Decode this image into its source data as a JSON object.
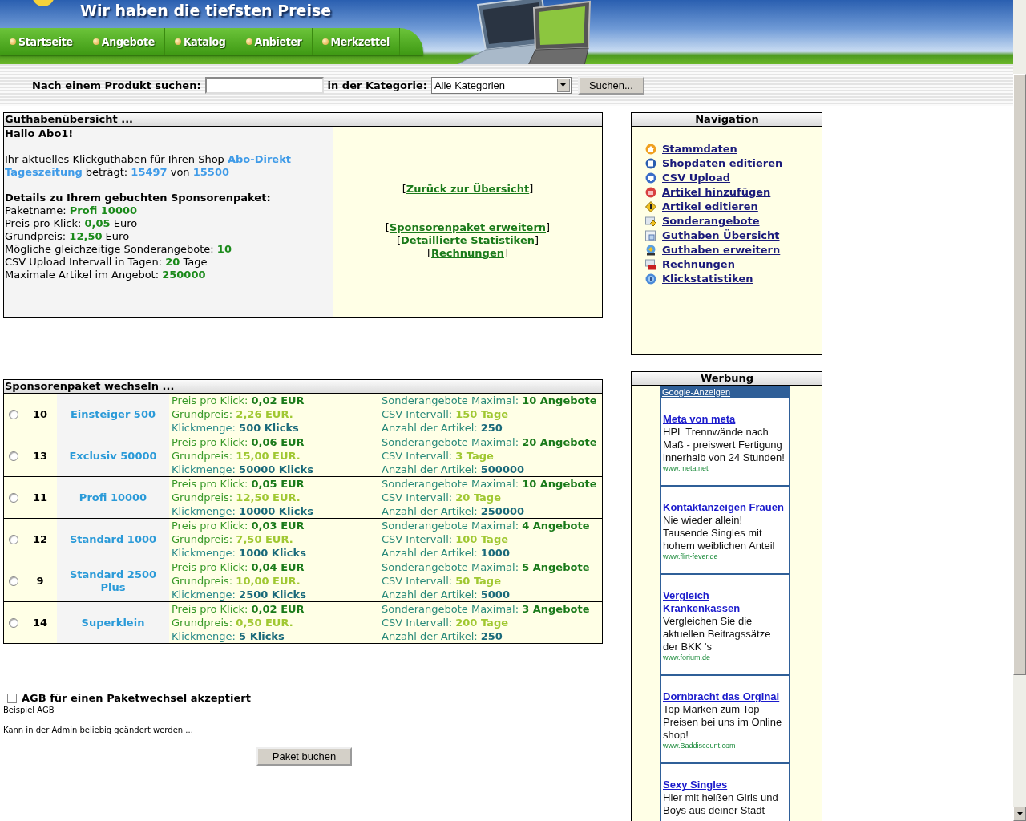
{
  "header": {
    "slogan": "Wir haben die tiefsten Preise",
    "tabs": [
      {
        "label": "Startseite"
      },
      {
        "label": "Angebote"
      },
      {
        "label": "Katalog"
      },
      {
        "label": "Anbieter"
      },
      {
        "label": "Merkzettel"
      }
    ]
  },
  "search": {
    "label": "Nach einem Produkt suchen:",
    "category_label": "in der Kategorie:",
    "category": "Alle Kategorien",
    "button": "Suchen..."
  },
  "balance": {
    "title": "Guthabenübersicht ...",
    "paragraphs": [
      [
        {
          "text": "Hallo Abo1!",
          "kind": "bold"
        }
      ],
      [
        {
          "text": "Ihr aktuelles Klickguthaben für Ihren Shop ",
          "kind": "plain"
        },
        {
          "text": "Abo-Direkt Tageszeitung",
          "kind": "blue"
        },
        {
          "text": " beträgt: ",
          "kind": "plain"
        },
        {
          "text": "15497",
          "kind": "blue"
        },
        {
          "text": " von ",
          "kind": "plain"
        },
        {
          "text": "15500",
          "kind": "blue"
        }
      ],
      [
        {
          "text": "Details zu Ihrem gebuchten Sponsorenpaket:",
          "kind": "bold"
        }
      ],
      [
        {
          "text": "Paketname: ",
          "kind": "plain"
        },
        {
          "text": "Profi 10000",
          "kind": "green"
        }
      ],
      [
        {
          "text": "Preis pro Klick: ",
          "kind": "plain"
        },
        {
          "text": "0,05",
          "kind": "green"
        },
        {
          "text": " Euro",
          "kind": "plain"
        }
      ],
      [
        {
          "text": "Grundpreis: ",
          "kind": "plain"
        },
        {
          "text": "12,50",
          "kind": "green"
        },
        {
          "text": " Euro",
          "kind": "plain"
        }
      ],
      [
        {
          "text": "Mögliche gleichzeitige Sonderangebote: ",
          "kind": "plain"
        },
        {
          "text": "10",
          "kind": "green"
        }
      ],
      [
        {
          "text": "CSV Upload Intervall in Tagen: ",
          "kind": "plain"
        },
        {
          "text": "20",
          "kind": "green"
        },
        {
          "text": " Tage",
          "kind": "plain"
        }
      ],
      [
        {
          "text": "Maximale Artikel im Angebot: ",
          "kind": "plain"
        },
        {
          "text": "250000",
          "kind": "green"
        }
      ]
    ],
    "link_groups": [
      [
        {
          "open": "[",
          "link": "Zurück zur Übersicht",
          "close": "]"
        }
      ],
      [
        {
          "open": "[",
          "link": "Sponsorenpaket erweitern",
          "close": "]"
        },
        {
          "open": "[",
          "link": "Detaillierte Statistiken",
          "close": "]"
        },
        {
          "open": "[",
          "link": "Rechnungen",
          "close": "]"
        }
      ]
    ]
  },
  "packages": {
    "title": "Sponsorenpaket wechseln ...",
    "rows": [
      {
        "selected": false,
        "id": "10",
        "name": "Einsteiger 500",
        "left": [
          {
            "kind": "dark",
            "label": "Preis pro Klick:",
            "value": "0,02 EUR"
          },
          {
            "kind": "lime",
            "label": "Grundpreis:",
            "value": "2,26 EUR."
          },
          {
            "kind": "teal",
            "label": "Klickmenge:",
            "value": "500 Klicks"
          }
        ],
        "right": [
          {
            "kind": "dark",
            "label": "Sonderangebote Maximal:",
            "value": "10 Angebote"
          },
          {
            "kind": "lime",
            "label": "CSV Intervall:",
            "value": "150 Tage"
          },
          {
            "kind": "teal",
            "label": "Anzahl der Artikel:",
            "value": "250"
          }
        ]
      },
      {
        "selected": false,
        "id": "13",
        "name": "Exclusiv 50000",
        "left": [
          {
            "kind": "dark",
            "label": "Preis pro Klick:",
            "value": "0,06 EUR"
          },
          {
            "kind": "lime",
            "label": "Grundpreis:",
            "value": "15,00 EUR."
          },
          {
            "kind": "teal",
            "label": "Klickmenge:",
            "value": "50000 Klicks"
          }
        ],
        "right": [
          {
            "kind": "dark",
            "label": "Sonderangebote Maximal:",
            "value": "20 Angebote"
          },
          {
            "kind": "lime",
            "label": "CSV Intervall:",
            "value": "3 Tage"
          },
          {
            "kind": "teal",
            "label": "Anzahl der Artikel:",
            "value": "500000"
          }
        ]
      },
      {
        "selected": false,
        "id": "11",
        "name": "Profi 10000",
        "left": [
          {
            "kind": "dark",
            "label": "Preis pro Klick:",
            "value": "0,05 EUR"
          },
          {
            "kind": "lime",
            "label": "Grundpreis:",
            "value": "12,50 EUR."
          },
          {
            "kind": "teal",
            "label": "Klickmenge:",
            "value": "10000 Klicks"
          }
        ],
        "right": [
          {
            "kind": "dark",
            "label": "Sonderangebote Maximal:",
            "value": "10 Angebote"
          },
          {
            "kind": "lime",
            "label": "CSV Intervall:",
            "value": "20 Tage"
          },
          {
            "kind": "teal",
            "label": "Anzahl der Artikel:",
            "value": "250000"
          }
        ]
      },
      {
        "selected": false,
        "id": "12",
        "name": "Standard 1000",
        "left": [
          {
            "kind": "dark",
            "label": "Preis pro Klick:",
            "value": "0,03 EUR"
          },
          {
            "kind": "lime",
            "label": "Grundpreis:",
            "value": "7,50 EUR."
          },
          {
            "kind": "teal",
            "label": "Klickmenge:",
            "value": "1000 Klicks"
          }
        ],
        "right": [
          {
            "kind": "dark",
            "label": "Sonderangebote Maximal:",
            "value": "4 Angebote"
          },
          {
            "kind": "lime",
            "label": "CSV Intervall:",
            "value": "100 Tage"
          },
          {
            "kind": "teal",
            "label": "Anzahl der Artikel:",
            "value": "1000"
          }
        ]
      },
      {
        "selected": false,
        "id": "9",
        "name": "Standard 2500 Plus",
        "left": [
          {
            "kind": "dark",
            "label": "Preis pro Klick:",
            "value": "0,04 EUR"
          },
          {
            "kind": "lime",
            "label": "Grundpreis:",
            "value": "10,00 EUR."
          },
          {
            "kind": "teal",
            "label": "Klickmenge:",
            "value": "2500 Klicks"
          }
        ],
        "right": [
          {
            "kind": "dark",
            "label": "Sonderangebote Maximal:",
            "value": "5 Angebote"
          },
          {
            "kind": "lime",
            "label": "CSV Intervall:",
            "value": "50 Tage"
          },
          {
            "kind": "teal",
            "label": "Anzahl der Artikel:",
            "value": "5000"
          }
        ]
      },
      {
        "selected": false,
        "id": "14",
        "name": "Superklein",
        "left": [
          {
            "kind": "dark",
            "label": "Preis pro Klick:",
            "value": "0,02 EUR"
          },
          {
            "kind": "lime",
            "label": "Grundpreis:",
            "value": "0,50 EUR."
          },
          {
            "kind": "teal",
            "label": "Klickmenge:",
            "value": "5 Klicks"
          }
        ],
        "right": [
          {
            "kind": "dark",
            "label": "Sonderangebote Maximal:",
            "value": "3 Angebote"
          },
          {
            "kind": "lime",
            "label": "CSV Intervall:",
            "value": "200 Tage"
          },
          {
            "kind": "teal",
            "label": "Anzahl der Artikel:",
            "value": "250"
          }
        ]
      }
    ]
  },
  "agb": {
    "checked": false,
    "label": "AGB für einen Paketwechsel akzeptiert",
    "title": "Beispiel AGB",
    "text": "Kann in der Admin beliebig geändert werden ...",
    "button": "Paket buchen"
  },
  "navigation": {
    "title": "Navigation",
    "items": [
      {
        "kind": "home",
        "label": "Stammdaten"
      },
      {
        "kind": "page",
        "label": "Shopdaten editieren"
      },
      {
        "kind": "monitor",
        "label": "CSV Upload"
      },
      {
        "kind": "plus",
        "label": "Artikel hinzufügen"
      },
      {
        "kind": "sign",
        "label": "Artikel editieren"
      },
      {
        "kind": "folder-sign",
        "label": "Sonderangebote"
      },
      {
        "kind": "window",
        "label": "Guthaben Übersicht"
      },
      {
        "kind": "globe",
        "label": "Guthaben erweitern"
      },
      {
        "kind": "folder-case",
        "label": "Rechnungen"
      },
      {
        "kind": "help",
        "label": "Klickstatistiken"
      }
    ]
  },
  "ads": {
    "title": "Werbung",
    "provider": "Google-Anzeigen",
    "items": [
      {
        "title": "Meta von meta",
        "text": "HPL Trennwände nach Maß - preiswert Fertigung innerhalb von 24 Stunden!",
        "url": "www.meta.net"
      },
      {
        "title": "Kontaktanzeigen Frauen",
        "text": "Nie wieder allein! Tausende Singles mit hohem weiblichen Anteil",
        "url": "www.flirt-fever.de"
      },
      {
        "title": "Vergleich Krankenkassen",
        "text": "Vergleichen Sie die aktuellen Beitragssätze der BKK 's",
        "url": "www.forium.de"
      },
      {
        "title": "Dornbracht das Orginal",
        "text": "Top Marken zum Top Preisen bei uns im Online shop!",
        "url": "www.Baddiscount.com"
      },
      {
        "title": "Sexy Singles",
        "text": "Hier mit heißen Girls und Boys aus deiner Stadt"
      }
    ]
  }
}
